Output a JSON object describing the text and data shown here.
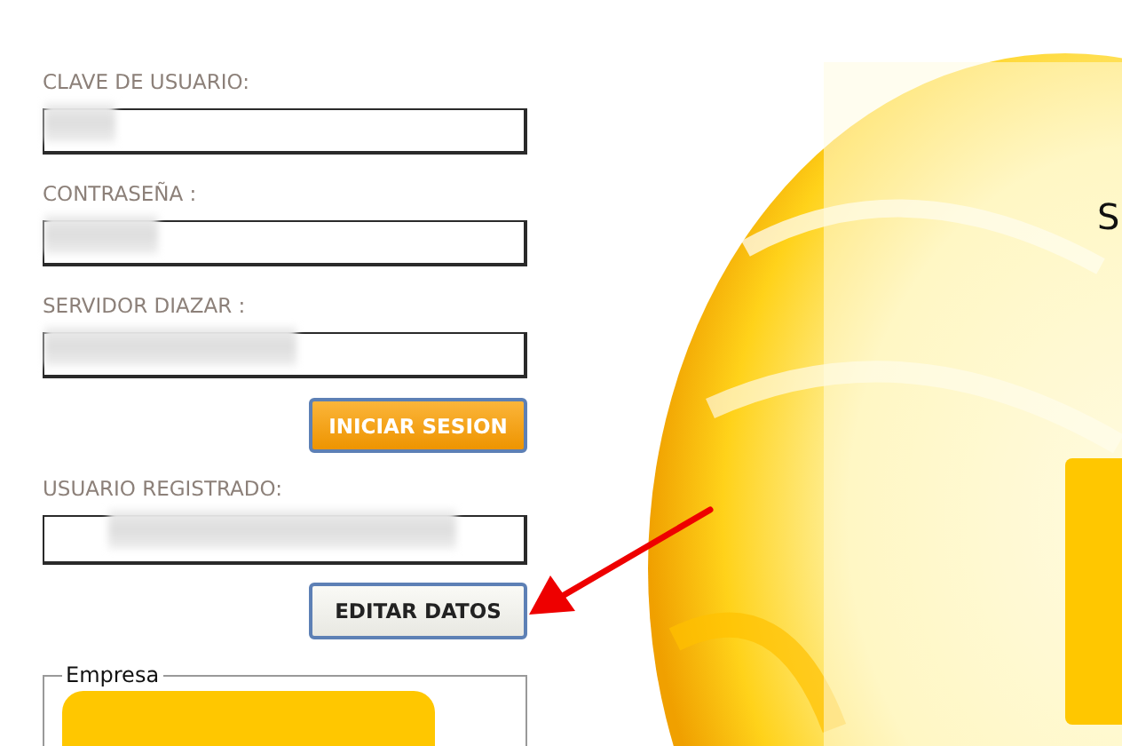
{
  "login": {
    "fields": [
      {
        "label": "CLAVE DE USUARIO:",
        "redacted": true
      },
      {
        "label": "CONTRASEÑA :",
        "redacted": true
      },
      {
        "label": "SERVIDOR DIAZAR :",
        "redacted": true
      }
    ],
    "button": "INICIAR SESION"
  },
  "registered": {
    "label": "USUARIO REGISTRADO:",
    "redacted": true,
    "button": "EDITAR DATOS"
  },
  "company": {
    "legend": "Empresa"
  },
  "banner": {
    "heading": "S"
  },
  "annotation": {
    "kind": "arrow"
  }
}
